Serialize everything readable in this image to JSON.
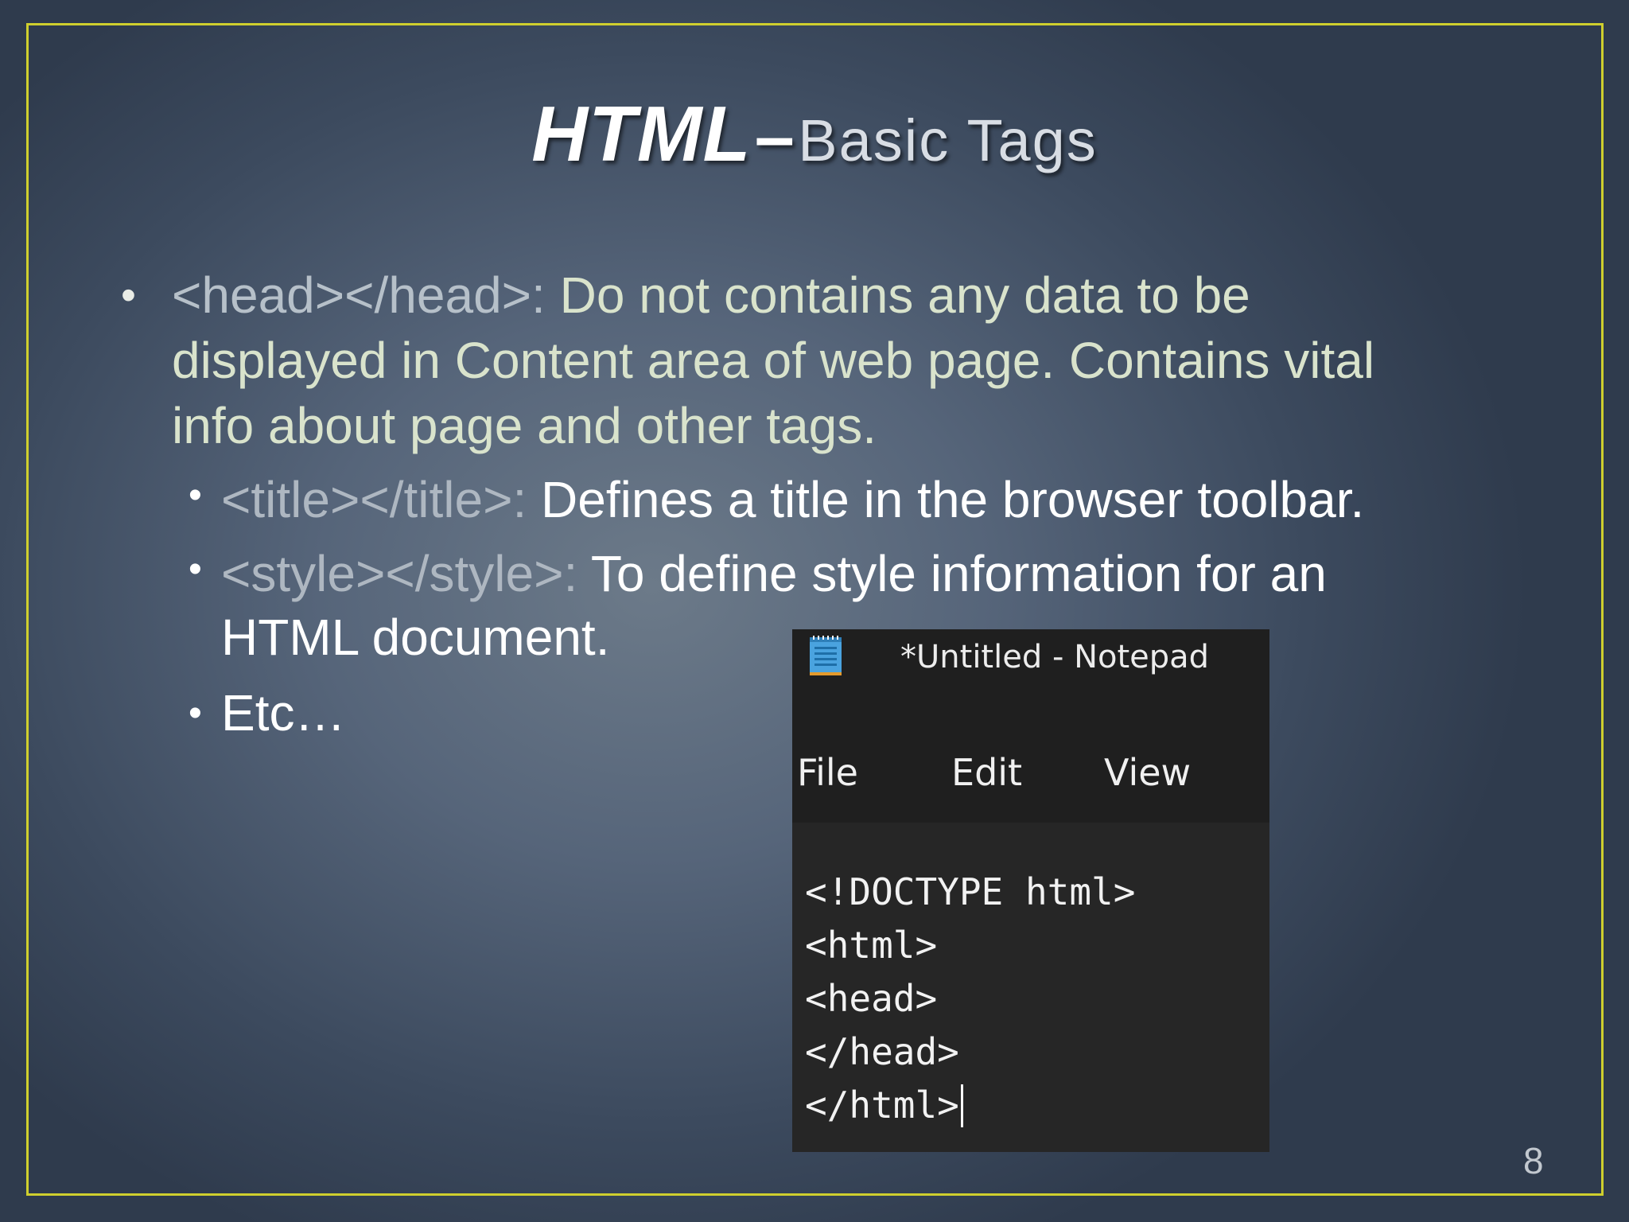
{
  "slide": {
    "title_main": "HTML",
    "title_dash": "–",
    "title_sub": "Basic Tags",
    "page_number": "8"
  },
  "bullets": {
    "head_tag": "<head></head>:",
    "head_desc_1": "Do not contains any data to be",
    "head_desc_2": "displayed in Content area of web page. Contains vital",
    "head_desc_3": "info about page and other tags.",
    "title_tag": "<title></title>:",
    "title_desc": "Defines a title in the browser toolbar.",
    "style_tag": "<style></style>:",
    "style_desc_1": "To define style information for an",
    "style_desc_2": "HTML document.",
    "etc": "Etc…",
    "bullet_symbol": "•"
  },
  "notepad": {
    "window_title": "*Untitled - Notepad",
    "icon": "notepad-icon",
    "menu": [
      "File",
      "Edit",
      "View"
    ],
    "lines": [
      "<!DOCTYPE html>",
      "<html>",
      "<head>",
      "</head>",
      "</html>"
    ]
  },
  "colors": {
    "frame": "#cfcf2e",
    "level1_text": "#d9e3cc",
    "level2_text": "#ffffff",
    "tag_text": "#b6c0c9"
  }
}
